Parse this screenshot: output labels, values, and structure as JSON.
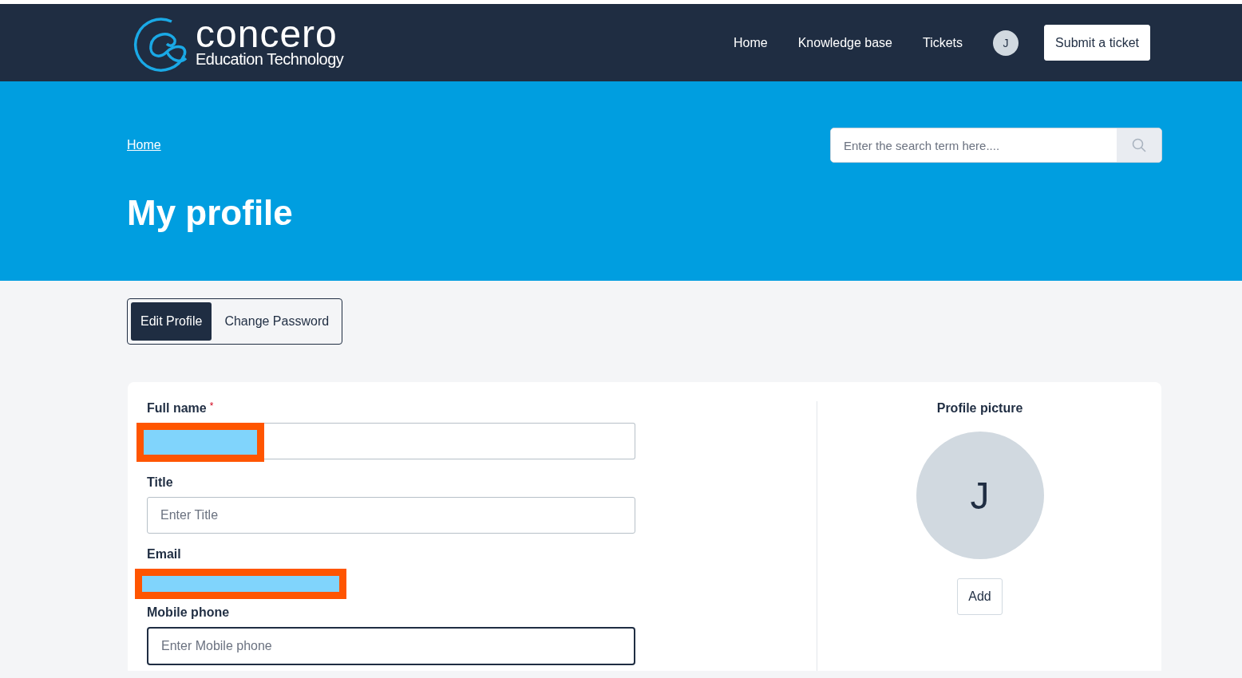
{
  "header": {
    "logo": {
      "name": "concero",
      "tagline": "Education Technology"
    },
    "nav": [
      {
        "label": "Home"
      },
      {
        "label": "Knowledge base"
      },
      {
        "label": "Tickets"
      }
    ],
    "avatar_initial": "J",
    "submit_button": "Submit a ticket"
  },
  "hero": {
    "breadcrumb": [
      "Home"
    ],
    "title": "My profile",
    "search": {
      "placeholder": "Enter the search term here...."
    }
  },
  "tabs": [
    {
      "label": "Edit Profile",
      "selected": true
    },
    {
      "label": "Change Password",
      "selected": false
    }
  ],
  "form": {
    "fields": [
      {
        "label": "Full name",
        "required_mark": "*",
        "kind": "redacted-input",
        "focused": false
      },
      {
        "label": "Title",
        "kind": "input",
        "placeholder": "Enter Title",
        "focused": false
      },
      {
        "label": "Email",
        "kind": "redacted",
        "focused": false
      },
      {
        "label": "Mobile phone",
        "kind": "input",
        "placeholder": "Enter Mobile phone",
        "focused": true
      }
    ]
  },
  "profile_picture": {
    "heading": "Profile picture",
    "initial": "J",
    "add_button": "Add"
  }
}
